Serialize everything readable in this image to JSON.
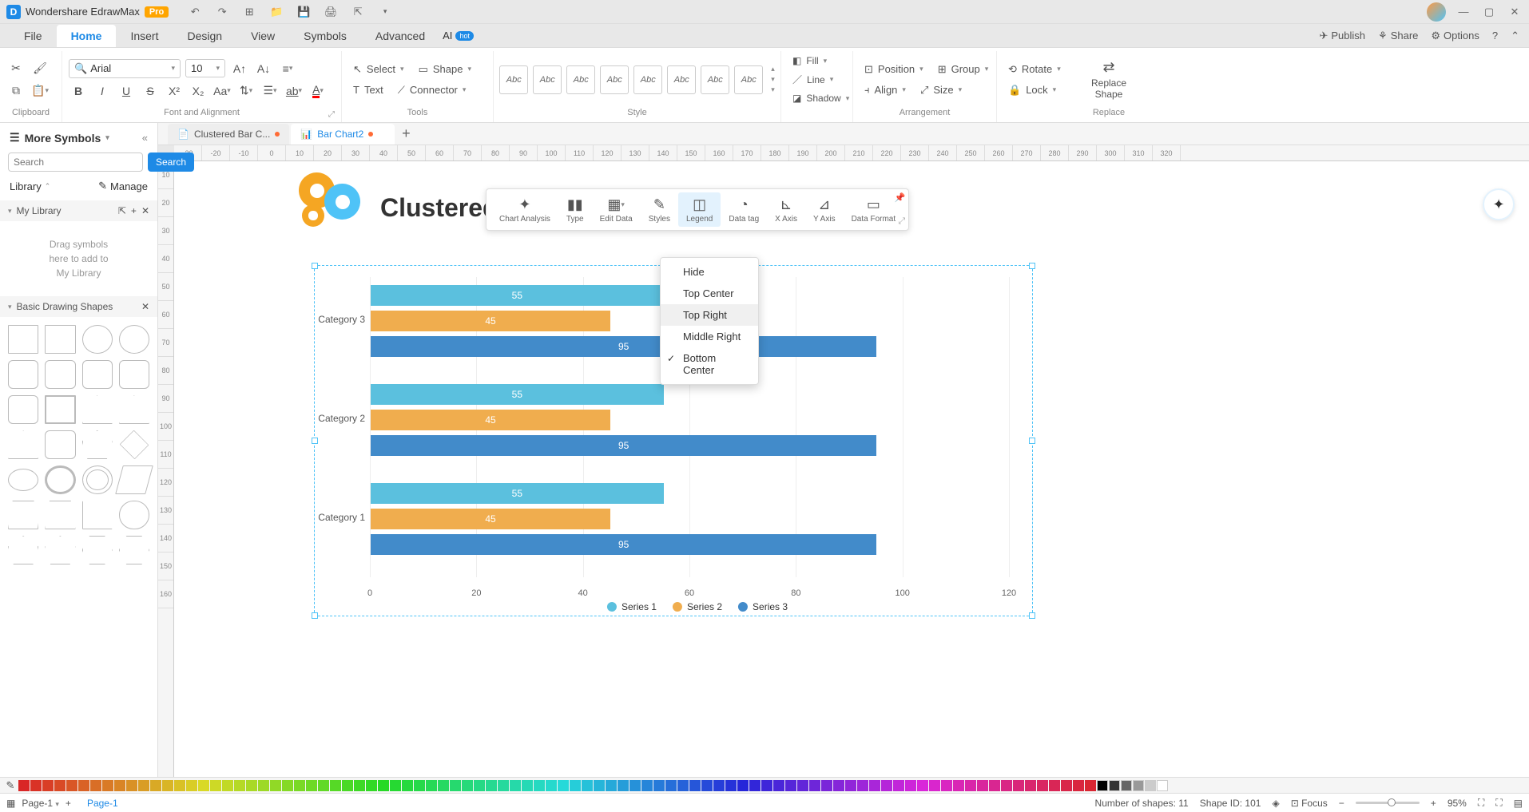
{
  "app": {
    "name": "Wondershare EdrawMax",
    "pro": "Pro"
  },
  "menu": {
    "tabs": [
      "File",
      "Home",
      "Insert",
      "Design",
      "View",
      "Symbols",
      "Advanced"
    ],
    "active": 1,
    "ai": "AI",
    "hot": "hot",
    "publish": "Publish",
    "share": "Share",
    "options": "Options"
  },
  "ribbon": {
    "clipboard": "Clipboard",
    "font_align": "Font and Alignment",
    "tools": "Tools",
    "style": "Style",
    "arrangement": "Arrangement",
    "replace": "Replace",
    "font_name": "Arial",
    "font_size": "10",
    "select": "Select",
    "shape": "Shape",
    "text": "Text",
    "connector": "Connector",
    "style_item": "Abc",
    "fill": "Fill",
    "line": "Line",
    "shadow": "Shadow",
    "position": "Position",
    "align": "Align",
    "group": "Group",
    "size": "Size",
    "rotate": "Rotate",
    "lock": "Lock",
    "replace_shape": "Replace Shape"
  },
  "doc_tabs": {
    "tab1": "Clustered Bar C...",
    "tab2": "Bar Chart2"
  },
  "left": {
    "more_symbols": "More Symbols",
    "search_ph": "Search",
    "search_btn": "Search",
    "library": "Library",
    "manage": "Manage",
    "my_library": "My Library",
    "drag_hint": "Drag symbols\nhere to add to\nMy Library",
    "basic_shapes": "Basic Drawing Shapes"
  },
  "ruler_h": [
    "-30",
    "-20",
    "-10",
    "0",
    "10",
    "20",
    "30",
    "40",
    "50",
    "60",
    "70",
    "80",
    "90",
    "100",
    "110",
    "120",
    "130",
    "140",
    "150",
    "160",
    "170",
    "180",
    "190",
    "200",
    "210",
    "220",
    "230",
    "240",
    "250",
    "260",
    "270",
    "280",
    "290",
    "300",
    "310",
    "320"
  ],
  "ruler_v": [
    "10",
    "20",
    "30",
    "40",
    "50",
    "60",
    "70",
    "80",
    "90",
    "100",
    "110",
    "120",
    "130",
    "140",
    "150",
    "160"
  ],
  "chart_title": "Clustered",
  "float": {
    "chart_analysis": "Chart Analysis",
    "type": "Type",
    "edit_data": "Edit Data",
    "styles": "Styles",
    "legend": "Legend",
    "data_tag": "Data tag",
    "x_axis": "X Axis",
    "y_axis": "Y Axis",
    "data_format": "Data Format"
  },
  "dropdown": {
    "hide": "Hide",
    "top_center": "Top Center",
    "top_right": "Top Right",
    "middle_right": "Middle Right",
    "bottom_center": "Bottom Center"
  },
  "chart_data": {
    "type": "bar",
    "orientation": "horizontal",
    "categories": [
      "Category 1",
      "Category 2",
      "Category 3"
    ],
    "series": [
      {
        "name": "Series 1",
        "color": "#5bc0de",
        "values": [
          55,
          55,
          55
        ]
      },
      {
        "name": "Series 2",
        "color": "#f0ad4e",
        "values": [
          45,
          45,
          45
        ]
      },
      {
        "name": "Series 3",
        "color": "#428bca",
        "values": [
          95,
          95,
          95
        ]
      }
    ],
    "x_ticks": [
      0,
      20,
      40,
      60,
      80,
      100,
      120
    ],
    "xlim": [
      0,
      120
    ],
    "legend_position": "Bottom Center"
  },
  "status": {
    "page_sel": "Page-1",
    "page_tab": "Page-1",
    "shapes": "Number of shapes: 11",
    "shape_id": "Shape ID: 101",
    "focus": "Focus",
    "zoom": "95%"
  }
}
